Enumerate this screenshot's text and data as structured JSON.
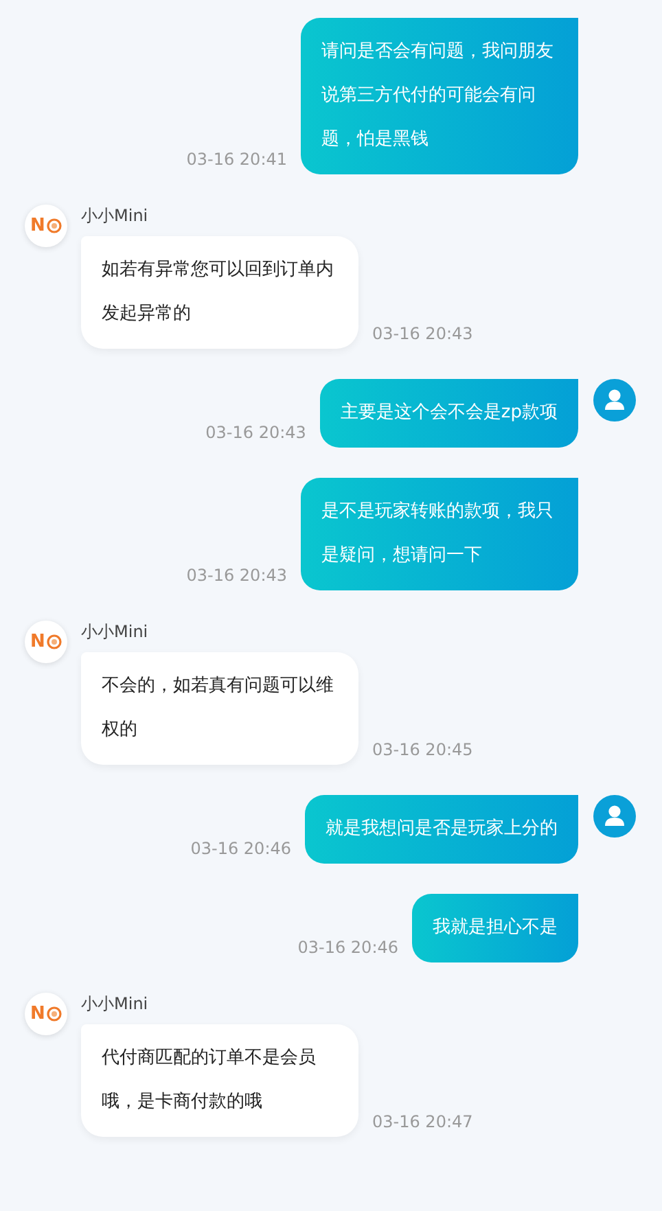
{
  "messages": [
    {
      "kind": "sent",
      "text": "请问是否会有问题，我问朋友说第三方代付的可能会有问题，怕是黑钱",
      "time": "03-16 20:41",
      "show_avatar": false
    },
    {
      "kind": "received",
      "sender": "小小Mini",
      "avatar_text": "N",
      "text": "如若有异常您可以回到订单内发起异常的",
      "time": "03-16 20:43"
    },
    {
      "kind": "sent",
      "text": "主要是这个会不会是zp款项",
      "time": "03-16 20:43",
      "show_avatar": true
    },
    {
      "kind": "sent",
      "text": "是不是玩家转账的款项，我只是疑问，想请问一下",
      "time": "03-16 20:43",
      "show_avatar": false
    },
    {
      "kind": "received",
      "sender": "小小Mini",
      "avatar_text": "N",
      "text": "不会的，如若真有问题可以维权的",
      "time": "03-16 20:45"
    },
    {
      "kind": "sent",
      "text": "就是我想问是否是玩家上分的",
      "time": "03-16 20:46",
      "show_avatar": true
    },
    {
      "kind": "sent",
      "text": "我就是担心不是",
      "time": "03-16 20:46",
      "show_avatar": false
    },
    {
      "kind": "received",
      "sender": "小小Mini",
      "avatar_text": "N",
      "text": "代付商匹配的订单不是会员哦，是卡商付款的哦",
      "time": "03-16 20:47"
    }
  ]
}
